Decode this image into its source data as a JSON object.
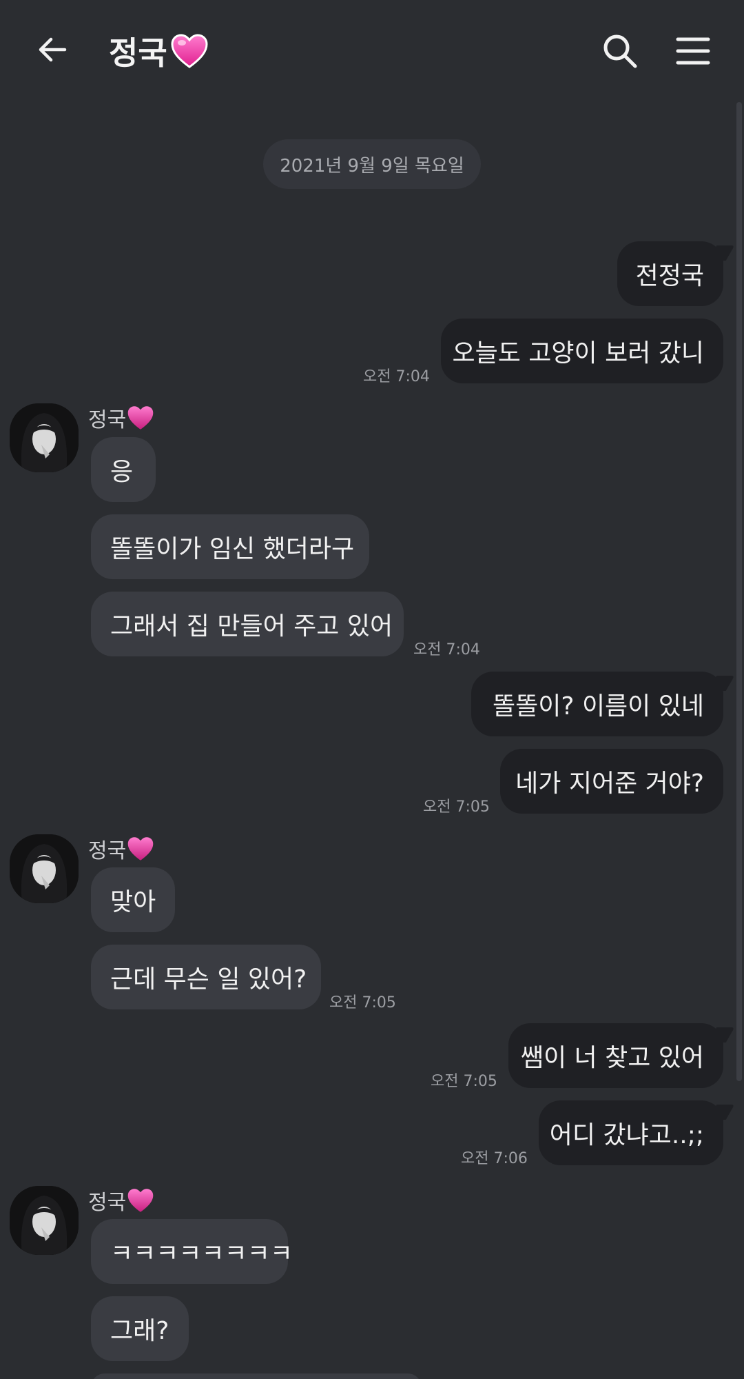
{
  "header": {
    "title": "정국",
    "back_icon": "back-arrow-icon",
    "search_icon": "search-icon",
    "menu_icon": "menu-icon",
    "accent_heart": "#ff4fb0"
  },
  "date_chip": "2021년 9월 9일 목요일",
  "sender": {
    "name": "정국"
  },
  "messages": {
    "m1": "전정국",
    "m2": "오늘도 고양이 보러 갔니",
    "t1": "오전 7:04",
    "r1": "응",
    "r2": "똘똘이가 임신 했더라구",
    "r3": "그래서 집 만들어 주고 있어",
    "t2": "오전 7:04",
    "m3": "똘똘이? 이름이 있네",
    "m4": "네가 지어준 거야?",
    "t3": "오전 7:05",
    "r4": "맞아",
    "r5": "근데 무슨 일 있어?",
    "t4": "오전 7:05",
    "m5": "쌤이 너 찾고 있어",
    "t5": "오전 7:05",
    "m6": "어디 갔냐고..;;",
    "t6": "오전 7:06",
    "r6": "ㅋㅋㅋㅋㅋㅋㅋㅋ",
    "r7": "그래?"
  },
  "colors": {
    "background": "#2b2d31",
    "outgoing_bubble": "#1f2024",
    "incoming_bubble": "#3a3c42",
    "timestamp": "#9c9ea3"
  }
}
